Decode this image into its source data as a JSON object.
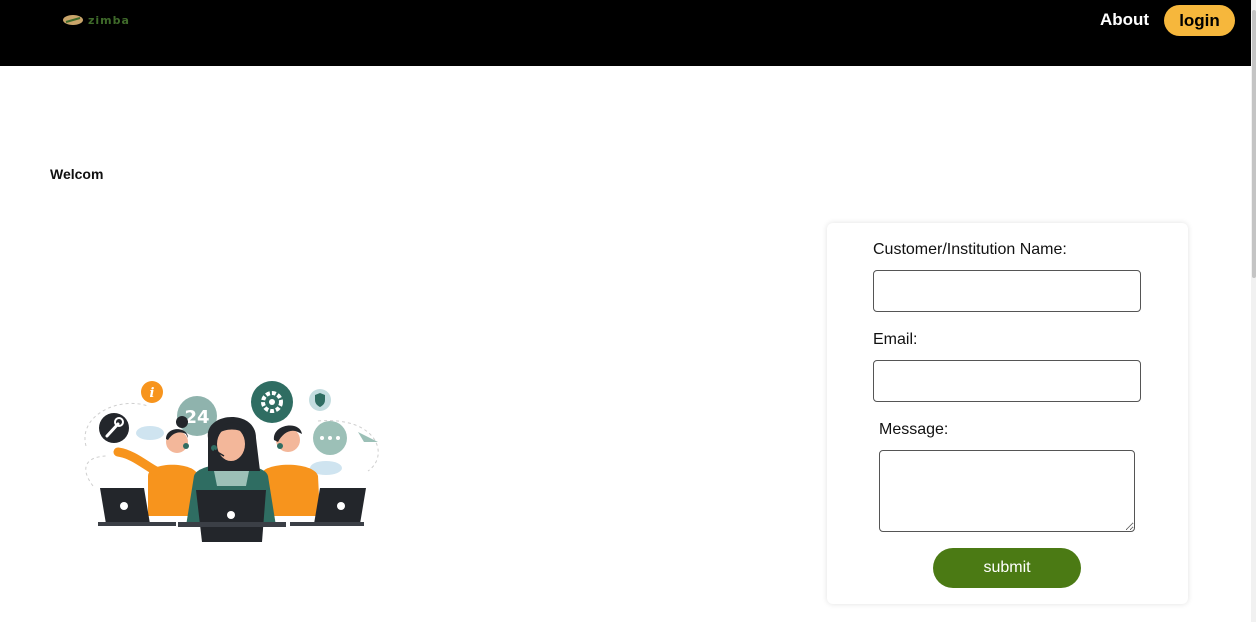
{
  "header": {
    "logo_text": "zimba",
    "nav": {
      "about": "About"
    },
    "login_label": "login"
  },
  "main": {
    "welcome_text": "Welcom",
    "illustration": {
      "badge_text": "24",
      "icon_names": [
        "info-icon",
        "gear-icon",
        "shield-icon",
        "wrench-icon",
        "chat-bubble-icon"
      ]
    }
  },
  "contact_form": {
    "name_label": "Customer/Institution Name:",
    "name_value": "",
    "email_label": "Email:",
    "email_value": "",
    "message_label": "Message:",
    "message_value": "",
    "submit_label": "submit"
  },
  "colors": {
    "header_bg": "#000000",
    "login_button": "#f6b73c",
    "submit_button": "#4b7a14",
    "illustration_orange": "#f7941d",
    "illustration_teal": "#2f6d62"
  }
}
